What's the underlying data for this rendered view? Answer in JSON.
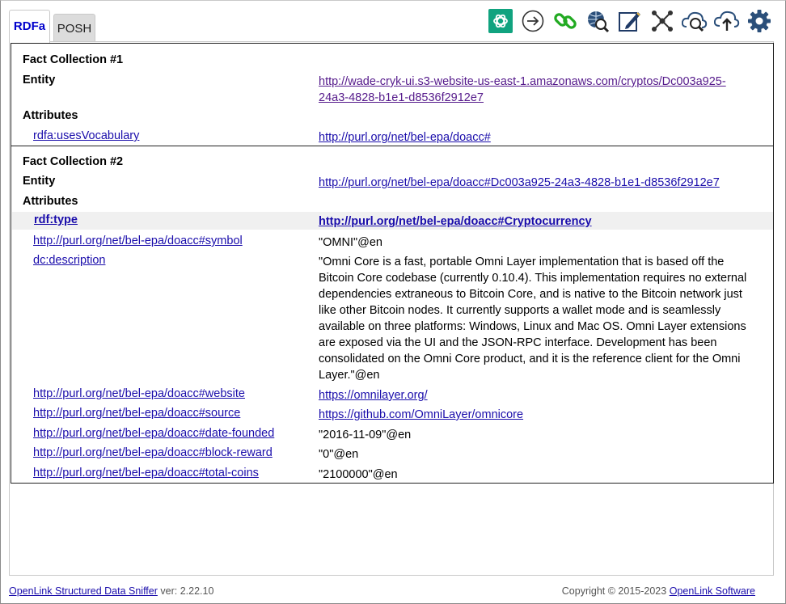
{
  "tabs": [
    {
      "label": "RDFa",
      "active": true
    },
    {
      "label": "POSH",
      "active": false
    }
  ],
  "toolbar": {
    "icons": [
      "chatgpt-icon",
      "login-arrow-icon",
      "chain-link-icon",
      "globe-search-icon",
      "edit-pencil-icon",
      "graph-network-icon",
      "cloud-search-icon",
      "cloud-upload-icon",
      "settings-gear-icon"
    ]
  },
  "fc1": {
    "title": "Fact Collection #1",
    "entity_label": "Entity",
    "entity_url_line1": "http://wade-cryk-ui.s3-website-us-east-1.amazonaws.com/cryptos/Dc003a925-",
    "entity_url_line2": "24a3-4828-b1e1-d8536f2912e7",
    "attributes_label": "Attributes",
    "attrs": [
      {
        "predicate": "rdfa:usesVocabulary",
        "value": "http://purl.org/net/bel-epa/doacc#"
      }
    ]
  },
  "fc2": {
    "title": "Fact Collection #2",
    "entity_label": "Entity",
    "entity_url": "http://purl.org/net/bel-epa/doacc#Dc003a925-24a3-4828-b1e1-d8536f2912e7",
    "attributes_label": "Attributes",
    "type_predicate": "rdf:type",
    "type_value": "http://purl.org/net/bel-epa/doacc#Cryptocurrency",
    "symbol_predicate": "http://purl.org/net/bel-epa/doacc#symbol",
    "symbol_value": "\"OMNI\"@en",
    "description_predicate": "dc:description",
    "description_lines": [
      "\"Omni Core is a fast, portable Omni Layer implementation that is based off the",
      "Bitcoin Core codebase (currently 0.10.4). This implementation requires no external",
      "dependencies extraneous to Bitcoin Core, and is native to the Bitcoin network just",
      "like other Bitcoin nodes. It currently supports a wallet mode and is seamlessly",
      "available on three platforms: Windows, Linux and Mac OS. Omni Layer extensions",
      "are exposed via the UI and the JSON-RPC interface. Development has been",
      "consolidated on the Omni Core product, and it is the reference client for the Omni",
      "Layer.\"@en"
    ],
    "website_predicate": "http://purl.org/net/bel-epa/doacc#website",
    "website_value": "https://omnilayer.org/",
    "source_predicate": "http://purl.org/net/bel-epa/doacc#source",
    "source_value": "https://github.com/OmniLayer/omnicore",
    "founded_predicate": "http://purl.org/net/bel-epa/doacc#date-founded",
    "founded_value": "\"2016-11-09\"@en",
    "reward_predicate": "http://purl.org/net/bel-epa/doacc#block-reward",
    "reward_value": "\"0\"@en",
    "coins_predicate": "http://purl.org/net/bel-epa/doacc#total-coins",
    "coins_value": "\"2100000\"@en"
  },
  "footer": {
    "app_link": "OpenLink Structured Data Sniffer",
    "version": " ver: 2.22.10",
    "copyright": "Copyright © 2015-2023 ",
    "company_link": "OpenLink Software"
  }
}
